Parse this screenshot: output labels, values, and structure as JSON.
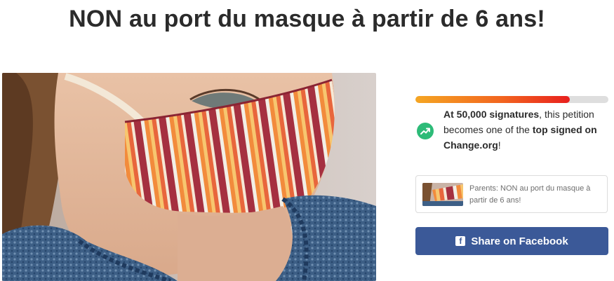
{
  "page": {
    "title": "NON au port du masque à partir de 6 ans!"
  },
  "progress": {
    "fraction": 0.8,
    "colors": [
      "#f5a623",
      "#e8201e"
    ]
  },
  "milestone": {
    "icon": "trending-up-icon",
    "icon_color": "#2dbb78",
    "prefix_bold": "At 50,000 signatures",
    "middle": ", this petition becomes one of the ",
    "highlight_bold": "top signed on Change.org",
    "suffix": "!"
  },
  "share_card": {
    "text": "Parents: NON au port du masque à partir de 6 ans!"
  },
  "facebook_button": {
    "icon": "facebook-icon",
    "label": "Share on Facebook",
    "color": "#3b5998"
  },
  "hero_image": {
    "subject": "child-wearing-striped-mask-photo"
  }
}
